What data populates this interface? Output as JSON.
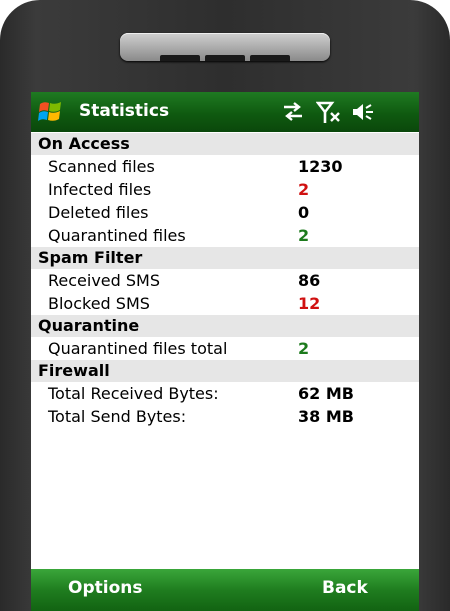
{
  "window": {
    "title": "Statistics"
  },
  "icons": {
    "start": "windows-flag-icon",
    "connectivity": "data-transfer-icon",
    "signal": "no-signal-icon",
    "volume": "speaker-icon"
  },
  "sections": {
    "on_access": {
      "title": "On Access",
      "scanned_label": "Scanned files",
      "scanned_value": "1230",
      "infected_label": "Infected files",
      "infected_value": "2",
      "deleted_label": "Deleted files",
      "deleted_value": "0",
      "quarantined_label": "Quarantined files",
      "quarantined_value": "2"
    },
    "spam_filter": {
      "title": "Spam Filter",
      "received_label": "Received SMS",
      "received_value": "86",
      "blocked_label": "Blocked SMS",
      "blocked_value": "12"
    },
    "quarantine": {
      "title": "Quarantine",
      "total_label": "Quarantined files total",
      "total_value": "2"
    },
    "firewall": {
      "title": "Firewall",
      "received_label": "Total Received Bytes:",
      "received_value": "62 MB",
      "send_label": "Total Send Bytes:",
      "send_value": "38 MB"
    }
  },
  "menu": {
    "left": "Options",
    "right": "Back"
  },
  "colors": {
    "title_bar": "#0f5a10",
    "menu_bar": "#1f7d1f",
    "red_value": "#d01010",
    "green_value": "#1c7a1c"
  }
}
